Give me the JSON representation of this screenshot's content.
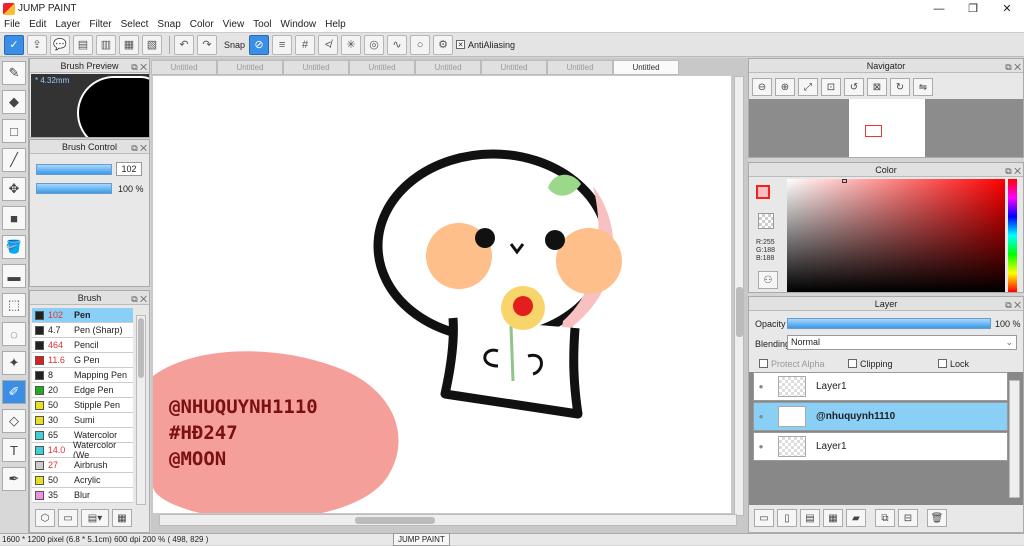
{
  "window": {
    "title": "JUMP PAINT",
    "min": "—",
    "max": "❐",
    "close": "✕"
  },
  "menu": [
    "File",
    "Edit",
    "Layer",
    "Filter",
    "Select",
    "Snap",
    "Color",
    "View",
    "Tool",
    "Window",
    "Help"
  ],
  "toolbar": {
    "snap_label": "Snap",
    "antialias_label": "AntiAliasing"
  },
  "brush_preview": {
    "title": "Brush Preview",
    "size": "* 4.32mm"
  },
  "brush_control": {
    "title": "Brush Control",
    "size_value": "102",
    "opacity_value": "100 %"
  },
  "brush_list": {
    "title": "Brush",
    "items": [
      {
        "size": "102",
        "name": "Pen",
        "color": "#222222",
        "size_red": true,
        "selected": true
      },
      {
        "size": "4.7",
        "name": "Pen (Sharp)",
        "color": "#222222",
        "size_red": false,
        "selected": false
      },
      {
        "size": "464",
        "name": "Pencil",
        "color": "#222222",
        "size_red": true,
        "selected": false
      },
      {
        "size": "11.6",
        "name": "G Pen",
        "color": "#e02020",
        "size_red": true,
        "selected": false
      },
      {
        "size": "8",
        "name": "Mapping Pen",
        "color": "#222222",
        "size_red": false,
        "selected": false
      },
      {
        "size": "20",
        "name": "Edge Pen",
        "color": "#22aa22",
        "size_red": false,
        "selected": false
      },
      {
        "size": "50",
        "name": "Stipple Pen",
        "color": "#e8e020",
        "size_red": false,
        "selected": false
      },
      {
        "size": "30",
        "name": "Sumi",
        "color": "#e8e020",
        "size_red": false,
        "selected": false
      },
      {
        "size": "65",
        "name": "Watercolor",
        "color": "#40d0d8",
        "size_red": false,
        "selected": false
      },
      {
        "size": "14.0",
        "name": "Watercolor (We",
        "color": "#40d0d8",
        "size_red": true,
        "selected": false
      },
      {
        "size": "27",
        "name": "Airbrush",
        "color": "#cccccc",
        "size_red": true,
        "selected": false
      },
      {
        "size": "50",
        "name": "Acrylic",
        "color": "#e8e020",
        "size_red": false,
        "selected": false
      },
      {
        "size": "35",
        "name": "Blur",
        "color": "#f090e0",
        "size_red": false,
        "selected": false
      }
    ]
  },
  "tabs": [
    "Untitled",
    "Untitled",
    "Untitled",
    "Untitled",
    "Untitled",
    "Untitled",
    "Untitled",
    "Untitled"
  ],
  "watermark": {
    "lines": [
      "@NHUQUYNH1110",
      "#HĐ247",
      "@MOON"
    ]
  },
  "navigator": {
    "title": "Navigator"
  },
  "color_panel": {
    "title": "Color",
    "r": "R:255",
    "g": "G:188",
    "b": "B:188"
  },
  "layer_panel": {
    "title": "Layer",
    "opacity_label": "Opacity",
    "opacity_value": "100 %",
    "blending_label": "Blending",
    "blending_value": "Normal",
    "protect_alpha": "Protect Alpha",
    "clipping": "Clipping",
    "lock": "Lock",
    "layers": [
      {
        "name": "Layer1",
        "selected": false
      },
      {
        "name": "@nhuquynh1110",
        "selected": true
      },
      {
        "name": "Layer1",
        "selected": false
      }
    ]
  },
  "status": {
    "info": "1600 * 1200 pixel   (6.8 * 5.1cm)   600 dpi   200 %   ( 498, 829 )",
    "app": "JUMP PAINT"
  }
}
